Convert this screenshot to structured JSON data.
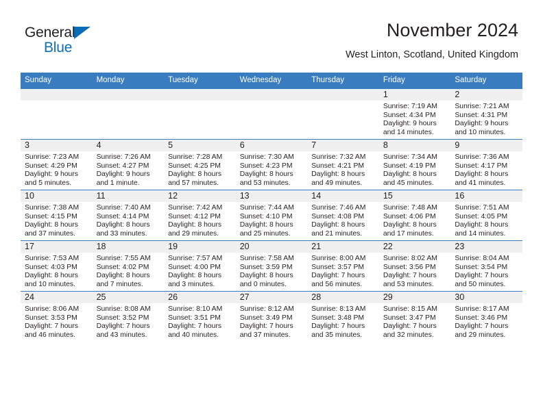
{
  "logo": {
    "word_one": "General",
    "word_two": "Blue",
    "triangle_icon": "triangle-icon",
    "brand_blue": "#0d6fb8",
    "text_dark": "#231f20"
  },
  "header": {
    "title": "November 2024",
    "location": "West Linton, Scotland, United Kingdom"
  },
  "calendar": {
    "header_bg": "#3a7cc0",
    "daynum_band_bg": "#f0f0f0",
    "weekday_headers": [
      "Sunday",
      "Monday",
      "Tuesday",
      "Wednesday",
      "Thursday",
      "Friday",
      "Saturday"
    ],
    "weeks": [
      [
        {
          "day": "",
          "lines": []
        },
        {
          "day": "",
          "lines": []
        },
        {
          "day": "",
          "lines": []
        },
        {
          "day": "",
          "lines": []
        },
        {
          "day": "",
          "lines": []
        },
        {
          "day": "1",
          "lines": [
            "Sunrise: 7:19 AM",
            "Sunset: 4:34 PM",
            "Daylight: 9 hours",
            "and 14 minutes."
          ]
        },
        {
          "day": "2",
          "lines": [
            "Sunrise: 7:21 AM",
            "Sunset: 4:31 PM",
            "Daylight: 9 hours",
            "and 10 minutes."
          ]
        }
      ],
      [
        {
          "day": "3",
          "lines": [
            "Sunrise: 7:23 AM",
            "Sunset: 4:29 PM",
            "Daylight: 9 hours",
            "and 5 minutes."
          ]
        },
        {
          "day": "4",
          "lines": [
            "Sunrise: 7:26 AM",
            "Sunset: 4:27 PM",
            "Daylight: 9 hours",
            "and 1 minute."
          ]
        },
        {
          "day": "5",
          "lines": [
            "Sunrise: 7:28 AM",
            "Sunset: 4:25 PM",
            "Daylight: 8 hours",
            "and 57 minutes."
          ]
        },
        {
          "day": "6",
          "lines": [
            "Sunrise: 7:30 AM",
            "Sunset: 4:23 PM",
            "Daylight: 8 hours",
            "and 53 minutes."
          ]
        },
        {
          "day": "7",
          "lines": [
            "Sunrise: 7:32 AM",
            "Sunset: 4:21 PM",
            "Daylight: 8 hours",
            "and 49 minutes."
          ]
        },
        {
          "day": "8",
          "lines": [
            "Sunrise: 7:34 AM",
            "Sunset: 4:19 PM",
            "Daylight: 8 hours",
            "and 45 minutes."
          ]
        },
        {
          "day": "9",
          "lines": [
            "Sunrise: 7:36 AM",
            "Sunset: 4:17 PM",
            "Daylight: 8 hours",
            "and 41 minutes."
          ]
        }
      ],
      [
        {
          "day": "10",
          "lines": [
            "Sunrise: 7:38 AM",
            "Sunset: 4:15 PM",
            "Daylight: 8 hours",
            "and 37 minutes."
          ]
        },
        {
          "day": "11",
          "lines": [
            "Sunrise: 7:40 AM",
            "Sunset: 4:14 PM",
            "Daylight: 8 hours",
            "and 33 minutes."
          ]
        },
        {
          "day": "12",
          "lines": [
            "Sunrise: 7:42 AM",
            "Sunset: 4:12 PM",
            "Daylight: 8 hours",
            "and 29 minutes."
          ]
        },
        {
          "day": "13",
          "lines": [
            "Sunrise: 7:44 AM",
            "Sunset: 4:10 PM",
            "Daylight: 8 hours",
            "and 25 minutes."
          ]
        },
        {
          "day": "14",
          "lines": [
            "Sunrise: 7:46 AM",
            "Sunset: 4:08 PM",
            "Daylight: 8 hours",
            "and 21 minutes."
          ]
        },
        {
          "day": "15",
          "lines": [
            "Sunrise: 7:48 AM",
            "Sunset: 4:06 PM",
            "Daylight: 8 hours",
            "and 17 minutes."
          ]
        },
        {
          "day": "16",
          "lines": [
            "Sunrise: 7:51 AM",
            "Sunset: 4:05 PM",
            "Daylight: 8 hours",
            "and 14 minutes."
          ]
        }
      ],
      [
        {
          "day": "17",
          "lines": [
            "Sunrise: 7:53 AM",
            "Sunset: 4:03 PM",
            "Daylight: 8 hours",
            "and 10 minutes."
          ]
        },
        {
          "day": "18",
          "lines": [
            "Sunrise: 7:55 AM",
            "Sunset: 4:02 PM",
            "Daylight: 8 hours",
            "and 7 minutes."
          ]
        },
        {
          "day": "19",
          "lines": [
            "Sunrise: 7:57 AM",
            "Sunset: 4:00 PM",
            "Daylight: 8 hours",
            "and 3 minutes."
          ]
        },
        {
          "day": "20",
          "lines": [
            "Sunrise: 7:58 AM",
            "Sunset: 3:59 PM",
            "Daylight: 8 hours",
            "and 0 minutes."
          ]
        },
        {
          "day": "21",
          "lines": [
            "Sunrise: 8:00 AM",
            "Sunset: 3:57 PM",
            "Daylight: 7 hours",
            "and 56 minutes."
          ]
        },
        {
          "day": "22",
          "lines": [
            "Sunrise: 8:02 AM",
            "Sunset: 3:56 PM",
            "Daylight: 7 hours",
            "and 53 minutes."
          ]
        },
        {
          "day": "23",
          "lines": [
            "Sunrise: 8:04 AM",
            "Sunset: 3:54 PM",
            "Daylight: 7 hours",
            "and 50 minutes."
          ]
        }
      ],
      [
        {
          "day": "24",
          "lines": [
            "Sunrise: 8:06 AM",
            "Sunset: 3:53 PM",
            "Daylight: 7 hours",
            "and 46 minutes."
          ]
        },
        {
          "day": "25",
          "lines": [
            "Sunrise: 8:08 AM",
            "Sunset: 3:52 PM",
            "Daylight: 7 hours",
            "and 43 minutes."
          ]
        },
        {
          "day": "26",
          "lines": [
            "Sunrise: 8:10 AM",
            "Sunset: 3:51 PM",
            "Daylight: 7 hours",
            "and 40 minutes."
          ]
        },
        {
          "day": "27",
          "lines": [
            "Sunrise: 8:12 AM",
            "Sunset: 3:49 PM",
            "Daylight: 7 hours",
            "and 37 minutes."
          ]
        },
        {
          "day": "28",
          "lines": [
            "Sunrise: 8:13 AM",
            "Sunset: 3:48 PM",
            "Daylight: 7 hours",
            "and 35 minutes."
          ]
        },
        {
          "day": "29",
          "lines": [
            "Sunrise: 8:15 AM",
            "Sunset: 3:47 PM",
            "Daylight: 7 hours",
            "and 32 minutes."
          ]
        },
        {
          "day": "30",
          "lines": [
            "Sunrise: 8:17 AM",
            "Sunset: 3:46 PM",
            "Daylight: 7 hours",
            "and 29 minutes."
          ]
        }
      ]
    ]
  }
}
